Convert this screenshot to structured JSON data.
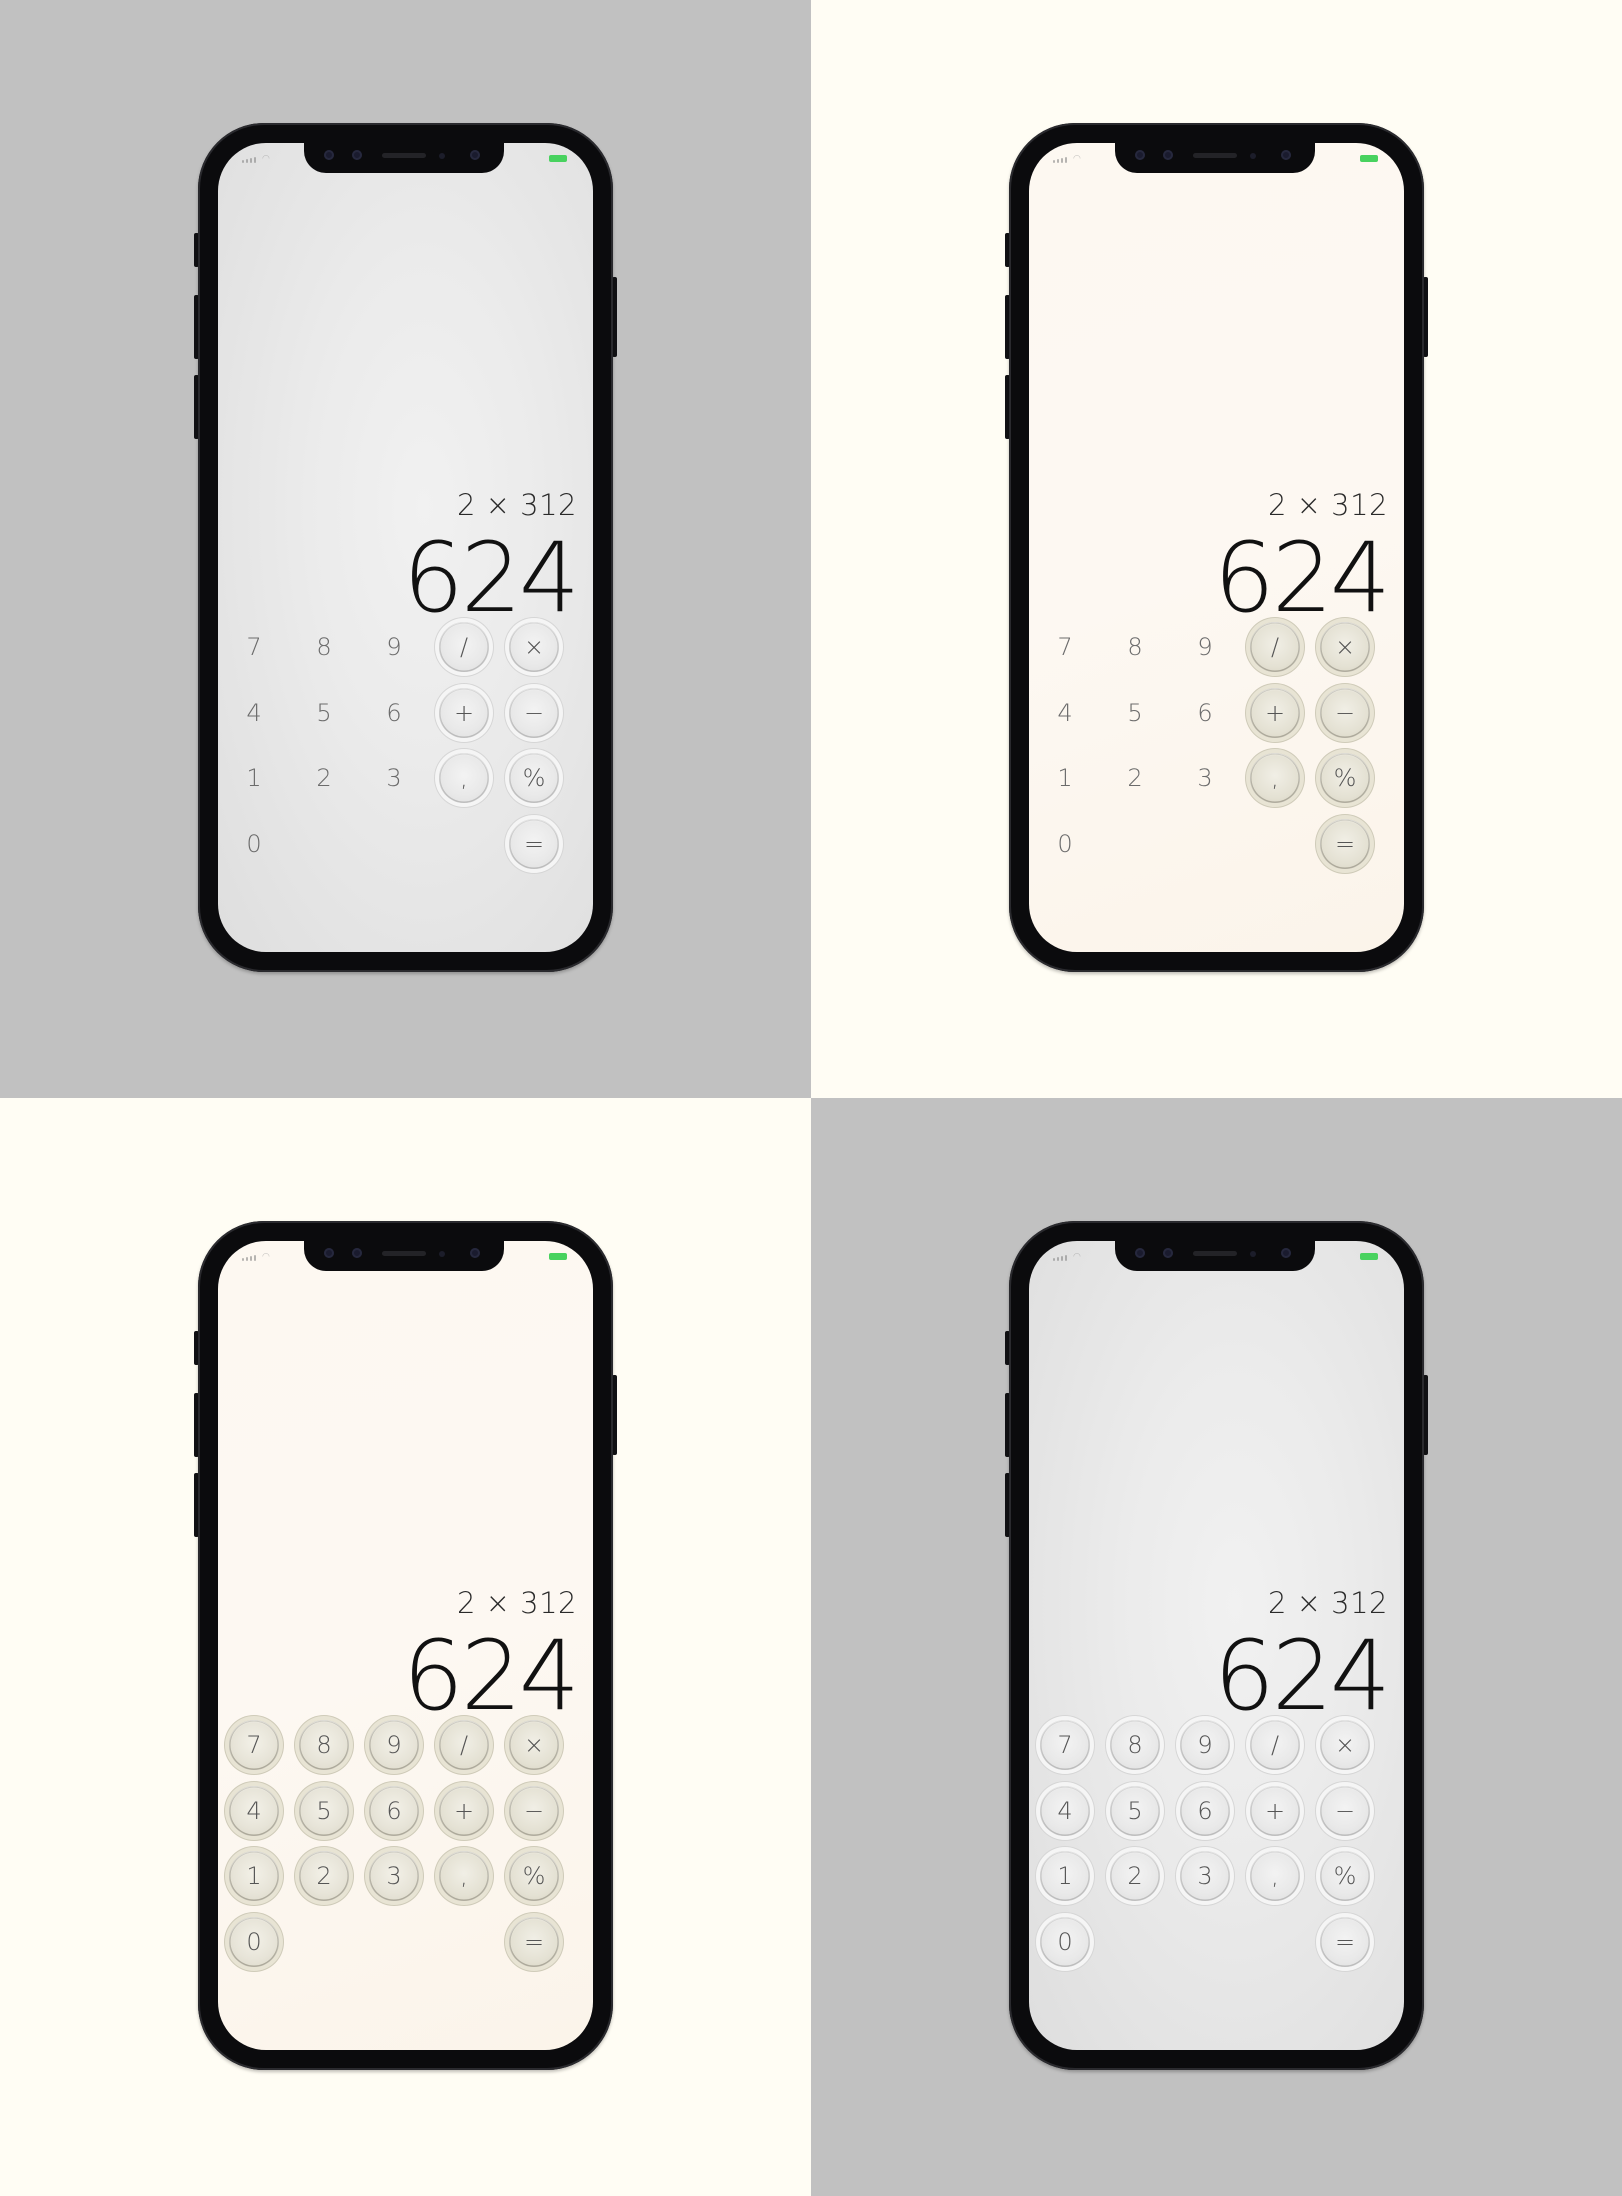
{
  "colors": {
    "quad_bg_grey": "#c1c1c1",
    "quad_bg_cream": "#fffdf4",
    "screen_grey_top": "#ebebeb",
    "screen_grey_bottom": "#dedede",
    "screen_cream_top": "#fdf8f1",
    "screen_cream_bottom": "#fbf4ea",
    "battery_green": "#48d25f",
    "phone_frame": "#0b0b0d"
  },
  "icons": {
    "signal": "cellular-signal-icon",
    "wifi": "wifi-icon",
    "battery": "battery-icon"
  },
  "calculator": {
    "expression": "2 × 312",
    "result": "624"
  },
  "keys": [
    {
      "label": "7",
      "row": 0,
      "col": 0
    },
    {
      "label": "8",
      "row": 0,
      "col": 1
    },
    {
      "label": "9",
      "row": 0,
      "col": 2
    },
    {
      "label": "/",
      "row": 0,
      "col": 3,
      "op": true
    },
    {
      "label": "×",
      "row": 0,
      "col": 4,
      "op": true
    },
    {
      "label": "4",
      "row": 1,
      "col": 0
    },
    {
      "label": "5",
      "row": 1,
      "col": 1
    },
    {
      "label": "6",
      "row": 1,
      "col": 2
    },
    {
      "label": "+",
      "row": 1,
      "col": 3,
      "op": true
    },
    {
      "label": "−",
      "row": 1,
      "col": 4,
      "op": true
    },
    {
      "label": "1",
      "row": 2,
      "col": 0
    },
    {
      "label": "2",
      "row": 2,
      "col": 1
    },
    {
      "label": "3",
      "row": 2,
      "col": 2
    },
    {
      "label": ",",
      "row": 2,
      "col": 3,
      "op": true
    },
    {
      "label": "%",
      "row": 2,
      "col": 4,
      "op": true
    },
    {
      "label": "0",
      "row": 3,
      "col": 0
    },
    {
      "label": "=",
      "row": 3,
      "col": 4,
      "op": true
    }
  ],
  "variants": [
    {
      "id": "grey-flat-digits",
      "theme": "grey",
      "background": "grey",
      "digits_as_buttons": false
    },
    {
      "id": "cream-flat-digits",
      "theme": "cream",
      "background": "cream",
      "digits_as_buttons": false
    },
    {
      "id": "cream-all-buttons",
      "theme": "cream",
      "background": "cream",
      "digits_as_buttons": true
    },
    {
      "id": "grey-all-buttons",
      "theme": "grey",
      "background": "grey",
      "digits_as_buttons": true
    }
  ]
}
